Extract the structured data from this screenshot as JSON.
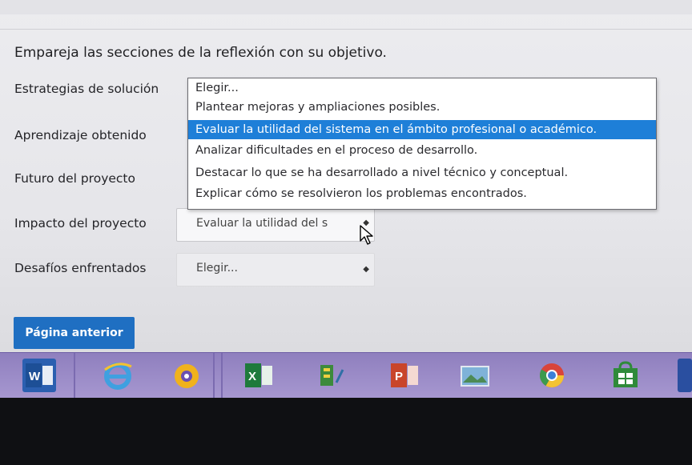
{
  "instruction": "Empareja las secciones de la reflexión con su objetivo.",
  "rows": [
    {
      "label": "Estrategias de solución"
    },
    {
      "label": "Aprendizaje obtenido"
    },
    {
      "label": "Futuro del proyecto"
    },
    {
      "label": "Impacto del proyecto",
      "value": "Evaluar la utilidad del s"
    },
    {
      "label": "Desafíos enfrentados",
      "value": "Elegir..."
    }
  ],
  "dropdown": {
    "options": [
      "Elegir...",
      "Plantear mejoras y ampliaciones posibles.",
      "Evaluar la utilidad del sistema en el ámbito profesional o académico.",
      "Analizar dificultades en el proceso de desarrollo.",
      "Destacar lo que se ha desarrollado a nivel técnico y conceptual.",
      "Explicar cómo se resolvieron los problemas encontrados."
    ],
    "highlighted_index": 2
  },
  "buttons": {
    "previous": "Página anterior"
  },
  "taskbar": {
    "apps": [
      "word-icon",
      "internet-explorer-icon",
      "paint-icon",
      "excel-icon",
      "projects-icon",
      "powerpoint-icon",
      "photos-icon",
      "chrome-icon",
      "store-icon"
    ],
    "colors": {
      "bar": "#a193cc",
      "accent": "#1f6fc2"
    }
  }
}
